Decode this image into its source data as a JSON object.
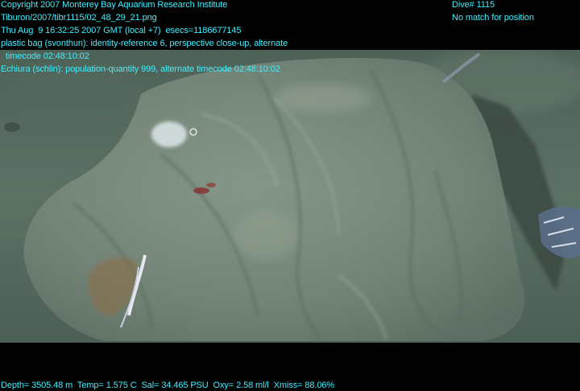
{
  "overlay": {
    "copyright": "Copyright 2007 Monterey Bay Aquarium Research Institute",
    "file_path": "Tiburon/2007/tibr1115/02_48_29_21.png",
    "datetime": "Thu Aug  9 16:32:25 2007 GMT (local +7)  esecs=1186677145",
    "annotation_1_line_1": "plastic bag (svonthun): identity-reference 6, perspective close-up, alternate",
    "annotation_1_line_2": "  timecode 02:48:10:02",
    "annotation_2": "Echiura (schlin): population-quantity 999, alternate timecode 02:48:10:02",
    "dive_number": "Dive# 1115",
    "position_status": "No match for position",
    "telemetry": "Depth= 3505.48 m  Temp= 1.575 C  Sal= 34.465 PSU  Oxy= 2.58 ml/l  Xmiss= 88.06%"
  },
  "colors": {
    "overlay_text": "#3ff0ff",
    "seafloor": "#5f7466",
    "plastic_bag": "#7c8c7f",
    "background": "#000000"
  }
}
